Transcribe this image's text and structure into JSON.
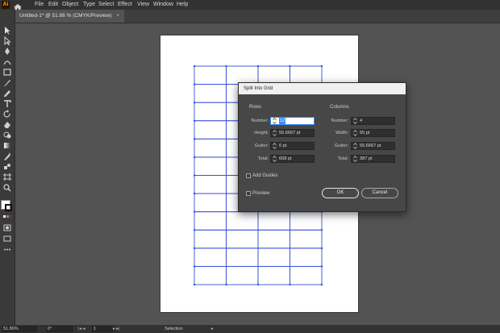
{
  "app": {
    "logo_text": "Ai"
  },
  "menu": [
    "File",
    "Edit",
    "Object",
    "Type",
    "Select",
    "Effect",
    "View",
    "Window",
    "Help"
  ],
  "tab": {
    "title": "Untitled-1* @ 51.86 % (CMYK/Preview)",
    "close": "×"
  },
  "grid": {
    "rows": 12,
    "columns": 4,
    "line_color": "#3a4fd0"
  },
  "dialog": {
    "title": "Split Into Grid",
    "rows": {
      "heading": "Rows",
      "number_label": "Number:",
      "number_value": "12",
      "height_label": "Height:",
      "height_value": "55.6667 pt",
      "gutter_label": "Gutter:",
      "gutter_value": "0 pt",
      "total_label": "Total:",
      "total_value": "668 pt"
    },
    "columns": {
      "heading": "Columns",
      "number_label": "Number:",
      "number_value": "4",
      "width_label": "Width:",
      "width_value": "55 pt",
      "gutter_label": "Gutter:",
      "gutter_value": "55.6667 pt",
      "total_label": "Total:",
      "total_value": "387 pt"
    },
    "add_guides": "Add Guides",
    "preview": "Preview",
    "ok": "OK",
    "cancel": "Cancel"
  },
  "status": {
    "zoom": "51.86%",
    "rotation": "0°",
    "artboard": "1",
    "tool": "Selection"
  }
}
